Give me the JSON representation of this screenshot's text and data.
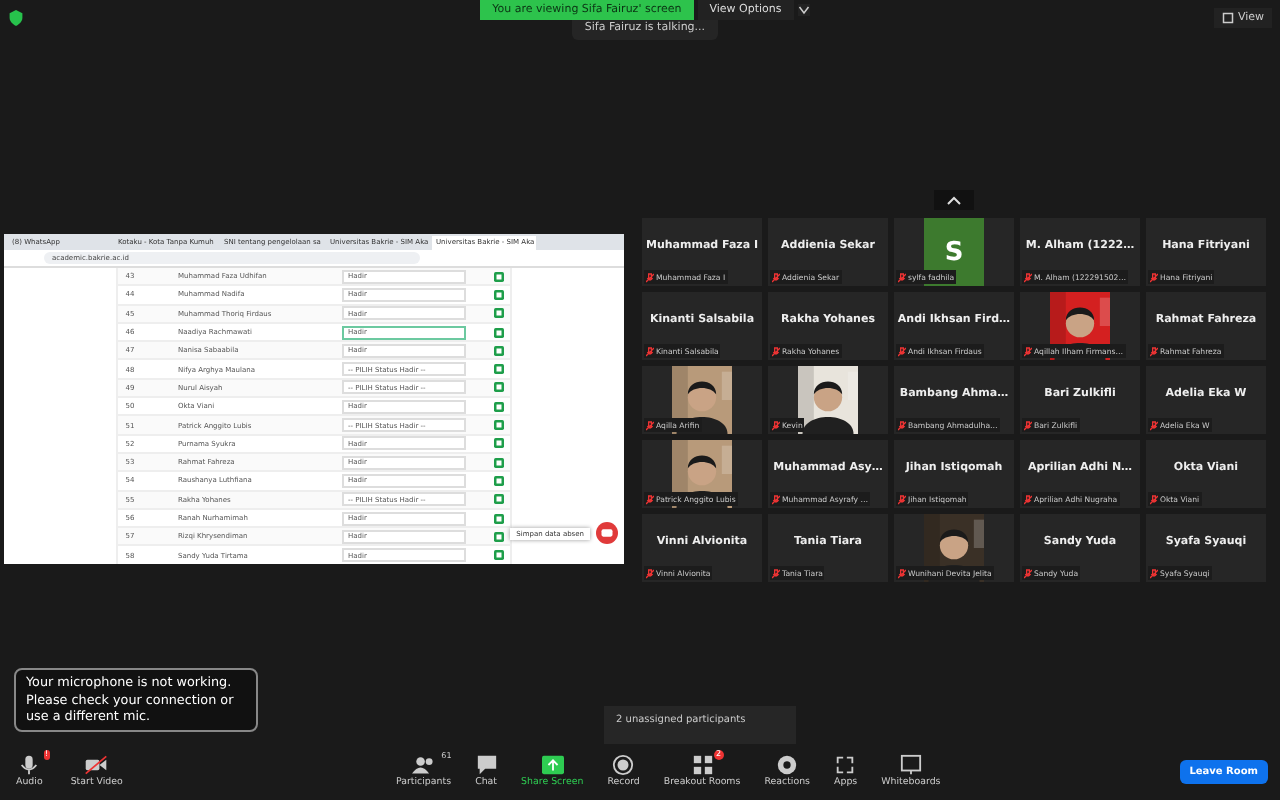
{
  "top": {
    "banner": "You are viewing Sifa Fairuz' screen",
    "view_options": "View Options",
    "talking": "Sifa Fairuz is talking...",
    "view": "View"
  },
  "shared_screen": {
    "tabs": [
      {
        "label": "(8) WhatsApp",
        "selected": false
      },
      {
        "label": "Kotaku - Kota Tanpa Kumuh",
        "selected": false
      },
      {
        "label": "SNI tentang pengelolaan sa",
        "selected": false
      },
      {
        "label": "Universitas Bakrie - SIM Aka",
        "selected": false
      },
      {
        "label": "Universitas Bakrie - SIM Aka",
        "selected": true
      }
    ],
    "url": "academic.bakrie.ac.id",
    "rows": [
      {
        "no": "43",
        "name": "Muhammad Faza Udhifan",
        "status": "Hadir",
        "focused": false
      },
      {
        "no": "44",
        "name": "Muhammad Nadifa",
        "status": "Hadir",
        "focused": false
      },
      {
        "no": "45",
        "name": "Muhammad Thoriq Firdaus",
        "status": "Hadir",
        "focused": false
      },
      {
        "no": "46",
        "name": "Naadiya Rachmawati",
        "status": "Hadir",
        "focused": true
      },
      {
        "no": "47",
        "name": "Nanisa Sabaabila",
        "status": "Hadir",
        "focused": false
      },
      {
        "no": "48",
        "name": "Nifya Arghya Maulana",
        "status": "-- PILIH Status Hadir --",
        "focused": false
      },
      {
        "no": "49",
        "name": "Nurul Aisyah",
        "status": "-- PILIH Status Hadir --",
        "focused": false
      },
      {
        "no": "50",
        "name": "Okta Viani",
        "status": "Hadir",
        "focused": false
      },
      {
        "no": "51",
        "name": "Patrick Anggito Lubis",
        "status": "-- PILIH Status Hadir --",
        "focused": false
      },
      {
        "no": "52",
        "name": "Purnama Syukra",
        "status": "Hadir",
        "focused": false
      },
      {
        "no": "53",
        "name": "Rahmat Fahreza",
        "status": "Hadir",
        "focused": false
      },
      {
        "no": "54",
        "name": "Raushanya Luthfiana",
        "status": "Hadir",
        "focused": false
      },
      {
        "no": "55",
        "name": "Rakha Yohanes",
        "status": "-- PILIH Status Hadir --",
        "focused": false
      },
      {
        "no": "56",
        "name": "Ranah Nurhamimah",
        "status": "Hadir",
        "focused": false
      },
      {
        "no": "57",
        "name": "Rizqi Khrysendiman",
        "status": "Hadir",
        "focused": false
      },
      {
        "no": "58",
        "name": "Sandy Yuda Tirtama",
        "status": "Hadir",
        "focused": false
      }
    ],
    "save_button": "Simpan data absen"
  },
  "gallery": [
    {
      "kind": "name",
      "name": "Muhammad Faza I",
      "label": "Muhammad Faza I"
    },
    {
      "kind": "name",
      "name": "Addienia Sekar",
      "label": "Addienia Sekar"
    },
    {
      "kind": "avatar",
      "letter": "S",
      "label": "sylfa fadhila"
    },
    {
      "kind": "name",
      "name": "M. Alham (1222…",
      "label": "M. Alham (122291502…"
    },
    {
      "kind": "name",
      "name": "Hana Fitriyani",
      "label": "Hana Fitriyani"
    },
    {
      "kind": "name",
      "name": "Kinanti Salsabila",
      "label": "Kinanti Salsabila"
    },
    {
      "kind": "name",
      "name": "Rakha Yohanes",
      "label": "Rakha Yohanes"
    },
    {
      "kind": "name",
      "name": "Andi Ikhsan Fird…",
      "label": "Andi Ikhsan Firdaus"
    },
    {
      "kind": "picture",
      "label": "Aqillah Ilham Firmans…"
    },
    {
      "kind": "name",
      "name": "Rahmat Fahreza",
      "label": "Rahmat Fahreza"
    },
    {
      "kind": "picture",
      "label": "Aqilla Arifin"
    },
    {
      "kind": "picture",
      "label": "Kevin"
    },
    {
      "kind": "name",
      "name": "Bambang Ahma…",
      "label": "Bambang Ahmadulha…"
    },
    {
      "kind": "name",
      "name": "Bari Zulkifli",
      "label": "Bari Zulkifli"
    },
    {
      "kind": "name",
      "name": "Adelia Eka W",
      "label": "Adelia Eka W"
    },
    {
      "kind": "picture",
      "label": "Patrick Anggito Lubis"
    },
    {
      "kind": "name",
      "name": "Muhammad Asy…",
      "label": "Muhammad Asyrafy …"
    },
    {
      "kind": "name",
      "name": "Jihan Istiqomah",
      "label": "Jihan Istiqomah"
    },
    {
      "kind": "name",
      "name": "Aprilian Adhi N…",
      "label": "Aprilian Adhi Nugraha"
    },
    {
      "kind": "name",
      "name": "Okta Viani",
      "label": "Okta Viani"
    },
    {
      "kind": "name",
      "name": "Vinni Alvionita",
      "label": "Vinni Alvionita"
    },
    {
      "kind": "name",
      "name": "Tania Tiara",
      "label": "Tania Tiara"
    },
    {
      "kind": "picture",
      "label": "Wunihani Devita Jelita"
    },
    {
      "kind": "name",
      "name": "Sandy Yuda",
      "label": "Sandy Yuda"
    },
    {
      "kind": "name",
      "name": "Syafa Syauqi",
      "label": "Syafa Syauqi"
    }
  ],
  "toast": "Your microphone is not working. Please check your connection or use a different mic.",
  "popup": "2 unassigned participants",
  "toolbar": [
    {
      "kind": "audio",
      "label": "Audio",
      "badge": "!"
    },
    {
      "kind": "video",
      "label": "Start Video"
    },
    {
      "kind": "participants",
      "label": "Participants",
      "count": "61"
    },
    {
      "kind": "chat",
      "label": "Chat"
    },
    {
      "kind": "share",
      "label": "Share Screen"
    },
    {
      "kind": "record",
      "label": "Record"
    },
    {
      "kind": "breakout",
      "label": "Breakout Rooms",
      "badge": "2"
    },
    {
      "kind": "reactions",
      "label": "Reactions"
    },
    {
      "kind": "apps",
      "label": "Apps"
    },
    {
      "kind": "whiteboards",
      "label": "Whiteboards"
    }
  ],
  "leave_button": "Leave Room"
}
